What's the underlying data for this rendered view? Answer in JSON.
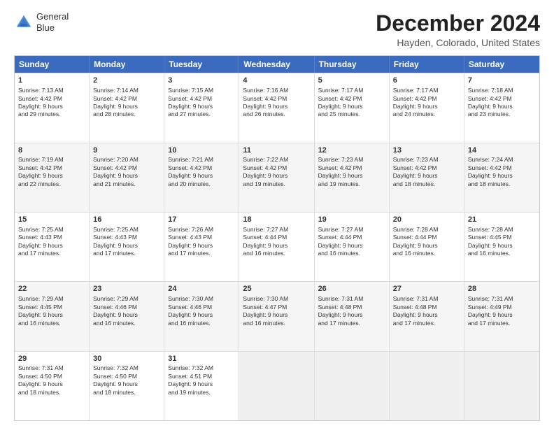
{
  "header": {
    "logo_line1": "General",
    "logo_line2": "Blue",
    "title": "December 2024",
    "subtitle": "Hayden, Colorado, United States"
  },
  "days_of_week": [
    "Sunday",
    "Monday",
    "Tuesday",
    "Wednesday",
    "Thursday",
    "Friday",
    "Saturday"
  ],
  "weeks": [
    [
      {
        "day": "1",
        "lines": [
          "Sunrise: 7:13 AM",
          "Sunset: 4:42 PM",
          "Daylight: 9 hours",
          "and 29 minutes."
        ]
      },
      {
        "day": "2",
        "lines": [
          "Sunrise: 7:14 AM",
          "Sunset: 4:42 PM",
          "Daylight: 9 hours",
          "and 28 minutes."
        ]
      },
      {
        "day": "3",
        "lines": [
          "Sunrise: 7:15 AM",
          "Sunset: 4:42 PM",
          "Daylight: 9 hours",
          "and 27 minutes."
        ]
      },
      {
        "day": "4",
        "lines": [
          "Sunrise: 7:16 AM",
          "Sunset: 4:42 PM",
          "Daylight: 9 hours",
          "and 26 minutes."
        ]
      },
      {
        "day": "5",
        "lines": [
          "Sunrise: 7:17 AM",
          "Sunset: 4:42 PM",
          "Daylight: 9 hours",
          "and 25 minutes."
        ]
      },
      {
        "day": "6",
        "lines": [
          "Sunrise: 7:17 AM",
          "Sunset: 4:42 PM",
          "Daylight: 9 hours",
          "and 24 minutes."
        ]
      },
      {
        "day": "7",
        "lines": [
          "Sunrise: 7:18 AM",
          "Sunset: 4:42 PM",
          "Daylight: 9 hours",
          "and 23 minutes."
        ]
      }
    ],
    [
      {
        "day": "8",
        "lines": [
          "Sunrise: 7:19 AM",
          "Sunset: 4:42 PM",
          "Daylight: 9 hours",
          "and 22 minutes."
        ]
      },
      {
        "day": "9",
        "lines": [
          "Sunrise: 7:20 AM",
          "Sunset: 4:42 PM",
          "Daylight: 9 hours",
          "and 21 minutes."
        ]
      },
      {
        "day": "10",
        "lines": [
          "Sunrise: 7:21 AM",
          "Sunset: 4:42 PM",
          "Daylight: 9 hours",
          "and 20 minutes."
        ]
      },
      {
        "day": "11",
        "lines": [
          "Sunrise: 7:22 AM",
          "Sunset: 4:42 PM",
          "Daylight: 9 hours",
          "and 19 minutes."
        ]
      },
      {
        "day": "12",
        "lines": [
          "Sunrise: 7:23 AM",
          "Sunset: 4:42 PM",
          "Daylight: 9 hours",
          "and 19 minutes."
        ]
      },
      {
        "day": "13",
        "lines": [
          "Sunrise: 7:23 AM",
          "Sunset: 4:42 PM",
          "Daylight: 9 hours",
          "and 18 minutes."
        ]
      },
      {
        "day": "14",
        "lines": [
          "Sunrise: 7:24 AM",
          "Sunset: 4:42 PM",
          "Daylight: 9 hours",
          "and 18 minutes."
        ]
      }
    ],
    [
      {
        "day": "15",
        "lines": [
          "Sunrise: 7:25 AM",
          "Sunset: 4:43 PM",
          "Daylight: 9 hours",
          "and 17 minutes."
        ]
      },
      {
        "day": "16",
        "lines": [
          "Sunrise: 7:25 AM",
          "Sunset: 4:43 PM",
          "Daylight: 9 hours",
          "and 17 minutes."
        ]
      },
      {
        "day": "17",
        "lines": [
          "Sunrise: 7:26 AM",
          "Sunset: 4:43 PM",
          "Daylight: 9 hours",
          "and 17 minutes."
        ]
      },
      {
        "day": "18",
        "lines": [
          "Sunrise: 7:27 AM",
          "Sunset: 4:44 PM",
          "Daylight: 9 hours",
          "and 16 minutes."
        ]
      },
      {
        "day": "19",
        "lines": [
          "Sunrise: 7:27 AM",
          "Sunset: 4:44 PM",
          "Daylight: 9 hours",
          "and 16 minutes."
        ]
      },
      {
        "day": "20",
        "lines": [
          "Sunrise: 7:28 AM",
          "Sunset: 4:44 PM",
          "Daylight: 9 hours",
          "and 16 minutes."
        ]
      },
      {
        "day": "21",
        "lines": [
          "Sunrise: 7:28 AM",
          "Sunset: 4:45 PM",
          "Daylight: 9 hours",
          "and 16 minutes."
        ]
      }
    ],
    [
      {
        "day": "22",
        "lines": [
          "Sunrise: 7:29 AM",
          "Sunset: 4:45 PM",
          "Daylight: 9 hours",
          "and 16 minutes."
        ]
      },
      {
        "day": "23",
        "lines": [
          "Sunrise: 7:29 AM",
          "Sunset: 4:46 PM",
          "Daylight: 9 hours",
          "and 16 minutes."
        ]
      },
      {
        "day": "24",
        "lines": [
          "Sunrise: 7:30 AM",
          "Sunset: 4:46 PM",
          "Daylight: 9 hours",
          "and 16 minutes."
        ]
      },
      {
        "day": "25",
        "lines": [
          "Sunrise: 7:30 AM",
          "Sunset: 4:47 PM",
          "Daylight: 9 hours",
          "and 16 minutes."
        ]
      },
      {
        "day": "26",
        "lines": [
          "Sunrise: 7:31 AM",
          "Sunset: 4:48 PM",
          "Daylight: 9 hours",
          "and 17 minutes."
        ]
      },
      {
        "day": "27",
        "lines": [
          "Sunrise: 7:31 AM",
          "Sunset: 4:48 PM",
          "Daylight: 9 hours",
          "and 17 minutes."
        ]
      },
      {
        "day": "28",
        "lines": [
          "Sunrise: 7:31 AM",
          "Sunset: 4:49 PM",
          "Daylight: 9 hours",
          "and 17 minutes."
        ]
      }
    ],
    [
      {
        "day": "29",
        "lines": [
          "Sunrise: 7:31 AM",
          "Sunset: 4:50 PM",
          "Daylight: 9 hours",
          "and 18 minutes."
        ]
      },
      {
        "day": "30",
        "lines": [
          "Sunrise: 7:32 AM",
          "Sunset: 4:50 PM",
          "Daylight: 9 hours",
          "and 18 minutes."
        ]
      },
      {
        "day": "31",
        "lines": [
          "Sunrise: 7:32 AM",
          "Sunset: 4:51 PM",
          "Daylight: 9 hours",
          "and 19 minutes."
        ]
      },
      null,
      null,
      null,
      null
    ]
  ]
}
